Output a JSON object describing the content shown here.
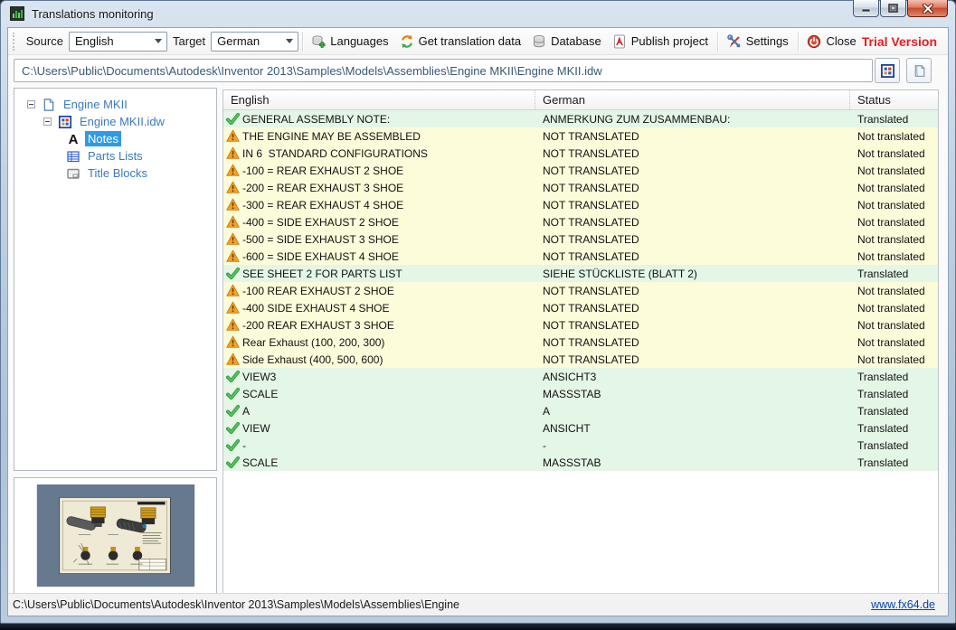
{
  "window": {
    "title": "Translations monitoring",
    "trial_label": "Trial Version"
  },
  "toolbar": {
    "source_label": "Source",
    "source_value": "English",
    "target_label": "Target",
    "target_value": "German",
    "buttons": {
      "languages": "Languages",
      "get_translation_data": "Get translation data",
      "database": "Database",
      "publish_project": "Publish project",
      "settings": "Settings",
      "close": "Close"
    }
  },
  "path_bar": {
    "value": "C:\\Users\\Public\\Documents\\Autodesk\\Inventor 2013\\Samples\\Models\\Assemblies\\Engine MKII\\Engine MKII.idw"
  },
  "tree": {
    "items": [
      {
        "label": "Engine MKII",
        "icon": "document-icon",
        "level": 0
      },
      {
        "label": "Engine MKII.idw",
        "icon": "drawing-blocks-icon",
        "level": 1
      },
      {
        "label": "Notes",
        "icon": "notes-a-icon",
        "level": 2,
        "selected": true
      },
      {
        "label": "Parts Lists",
        "icon": "parts-list-icon",
        "level": 2
      },
      {
        "label": "Title Blocks",
        "icon": "title-block-icon",
        "level": 2
      }
    ]
  },
  "table": {
    "columns": [
      "English",
      "German",
      "Status"
    ],
    "rows": [
      {
        "en": "GENERAL ASSEMBLY NOTE:",
        "de": "ANMERKUNG ZUM ZUSAMMENBAU:",
        "status": "Translated",
        "translated": true
      },
      {
        "en": "THE ENGINE MAY BE ASSEMBLED",
        "de": "NOT TRANSLATED",
        "status": "Not translated",
        "translated": false
      },
      {
        "en": "IN 6  STANDARD CONFIGURATIONS",
        "de": "NOT TRANSLATED",
        "status": "Not translated",
        "translated": false
      },
      {
        "en": "-100 = REAR EXHAUST 2 SHOE",
        "de": "NOT TRANSLATED",
        "status": "Not translated",
        "translated": false
      },
      {
        "en": "-200 = REAR EXHAUST 3 SHOE",
        "de": "NOT TRANSLATED",
        "status": "Not translated",
        "translated": false
      },
      {
        "en": "-300 = REAR EXHAUST 4 SHOE",
        "de": "NOT TRANSLATED",
        "status": "Not translated",
        "translated": false
      },
      {
        "en": "-400 = SIDE EXHAUST 2 SHOE",
        "de": "NOT TRANSLATED",
        "status": "Not translated",
        "translated": false
      },
      {
        "en": "-500 = SIDE EXHAUST 3 SHOE",
        "de": "NOT TRANSLATED",
        "status": "Not translated",
        "translated": false
      },
      {
        "en": "-600 = SIDE EXHAUST 4 SHOE",
        "de": "NOT TRANSLATED",
        "status": "Not translated",
        "translated": false
      },
      {
        "en": "SEE SHEET 2 FOR PARTS LIST",
        "de": "SIEHE STÜCKLISTE (BLATT 2)",
        "status": "Translated",
        "translated": true
      },
      {
        "en": "-100 REAR EXHAUST 2 SHOE",
        "de": "NOT TRANSLATED",
        "status": "Not translated",
        "translated": false
      },
      {
        "en": "-400 SIDE EXHAUST 4 SHOE",
        "de": "NOT TRANSLATED",
        "status": "Not translated",
        "translated": false
      },
      {
        "en": "-200 REAR EXHAUST 3 SHOE",
        "de": "NOT TRANSLATED",
        "status": "Not translated",
        "translated": false
      },
      {
        "en": "Rear Exhaust (100, 200, 300)",
        "de": "NOT TRANSLATED",
        "status": "Not translated",
        "translated": false
      },
      {
        "en": "Side Exhaust (400, 500, 600)",
        "de": "NOT TRANSLATED",
        "status": "Not translated",
        "translated": false
      },
      {
        "en": "VIEW3",
        "de": "ANSICHT3",
        "status": "Translated",
        "translated": true
      },
      {
        "en": "SCALE",
        "de": "MASSSTAB",
        "status": "Translated",
        "translated": true
      },
      {
        "en": "A",
        "de": "A",
        "status": "Translated",
        "translated": true
      },
      {
        "en": "VIEW",
        "de": "ANSICHT",
        "status": "Translated",
        "translated": true
      },
      {
        "en": "-",
        "de": "-",
        "status": "Translated",
        "translated": true
      },
      {
        "en": "SCALE",
        "de": "MASSSTAB",
        "status": "Translated",
        "translated": true
      }
    ]
  },
  "status_bar": {
    "path": "C:\\Users\\Public\\Documents\\Autodesk\\Inventor 2013\\Samples\\Models\\Assemblies\\Engine",
    "link": "www.fx64.de"
  },
  "colors": {
    "translated_row": "#e4f6e6",
    "not_translated_row": "#fcfbda",
    "tree_selection": "#2f9ae8",
    "tree_text": "#3a7abd",
    "trial_text": "#e31e24",
    "check_icon": "#3fae46",
    "warning_icon": "#f0a12c"
  }
}
